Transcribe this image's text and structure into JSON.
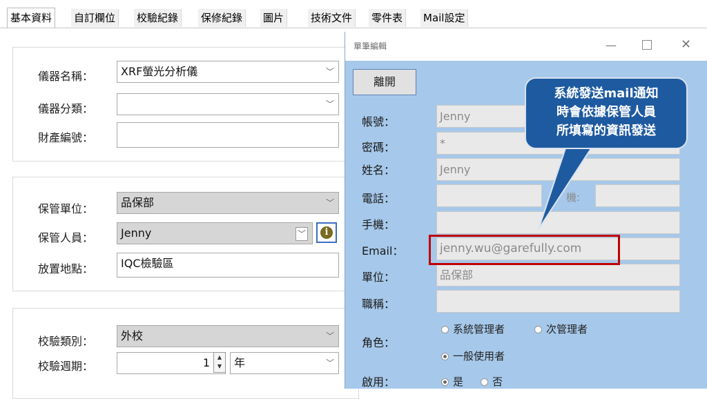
{
  "tabs": [
    "基本資料",
    "自訂欄位",
    "校驗紀錄",
    "保修紀錄",
    "圖片",
    "技術文件",
    "零件表",
    "Mail設定"
  ],
  "form": {
    "instrument_name_label": "儀器名稱：",
    "instrument_name_value": "XRF螢光分析儀",
    "instrument_category_label": "儀器分類：",
    "instrument_category_value": "",
    "asset_number_label": "財產編號：",
    "asset_number_value": "",
    "custody_unit_label": "保管單位：",
    "custody_unit_value": "品保部",
    "custodian_label": "保管人員：",
    "custodian_value": "Jenny",
    "location_label": "放置地點：",
    "location_value": "IQC檢驗區",
    "calib_type_label": "校驗類別：",
    "calib_type_value": "外校",
    "calib_cycle_label": "校驗週期：",
    "calib_cycle_value": "1",
    "calib_cycle_unit": "年"
  },
  "dialog": {
    "title": "單筆編輯",
    "leave_button": "離開",
    "account_label": "帳號：",
    "account_value": "Jenny",
    "password_label": "密碼：",
    "password_value": "*",
    "name_label": "姓名：",
    "name_value": "Jenny",
    "phone_label": "電話：",
    "ext_label": "機:",
    "mobile_label": "手機：",
    "email_label": "Email：",
    "email_value": "jenny.wu@garefully.com",
    "unit_label": "單位：",
    "unit_value": "品保部",
    "title_label": "職稱：",
    "role_label": "角色：",
    "role_options": [
      "系統管理者",
      "次管理者",
      "一般使用者"
    ],
    "enabled_label": "啟用：",
    "enabled_options": [
      "是",
      "否"
    ]
  },
  "callout": {
    "line1": "系統發送mail通知",
    "line2": "時會依據保管人員",
    "line3": "所填寫的資訊發送"
  }
}
